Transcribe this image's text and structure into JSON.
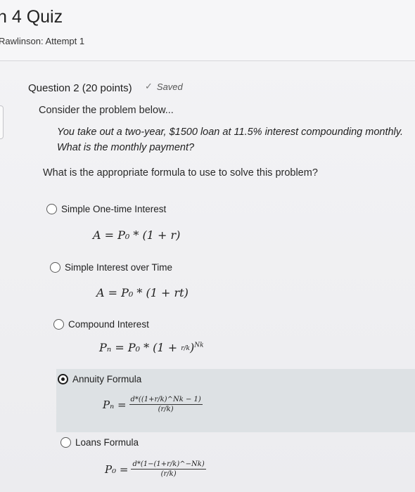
{
  "header": {
    "title": "n 4 Quiz",
    "attempt": "Rawlinson: Attempt 1"
  },
  "question": {
    "heading": "Question 2 (20 points)",
    "saved_label": "Saved",
    "intro": "Consider the problem below...",
    "scenario_line1": "You take out a two-year, $1500 loan at 11.5% interest compounding monthly.",
    "scenario_line2": "What is the monthly payment?",
    "prompt": "What is the appropriate formula to use to solve this problem?"
  },
  "options": [
    {
      "label": "Simple One-time Interest",
      "formula": "A = P₀ * (1 + r)",
      "selected": false
    },
    {
      "label": "Simple Interest over Time",
      "formula": "A = P₀ * (1 + rt)",
      "selected": false
    },
    {
      "label": "Compound Interest",
      "formula_lhs": "Pₙ = P₀ * (1 + ",
      "formula_frac": "r/k",
      "formula_sup": "Nk",
      "selected": false
    },
    {
      "label": "Annuity Formula",
      "formula_lhs": "Pₙ =",
      "num": "d*((1+r/k)^Nk − 1)",
      "den": "(r/k)",
      "selected": true
    },
    {
      "label": "Loans Formula",
      "formula_lhs": "P₀ =",
      "num": "d*(1−(1+r/k)^−Nk)",
      "den": "(r/k)",
      "selected": false
    }
  ],
  "colors": {
    "selected_band": "#dde1e4",
    "background": "#f1f1f3"
  }
}
